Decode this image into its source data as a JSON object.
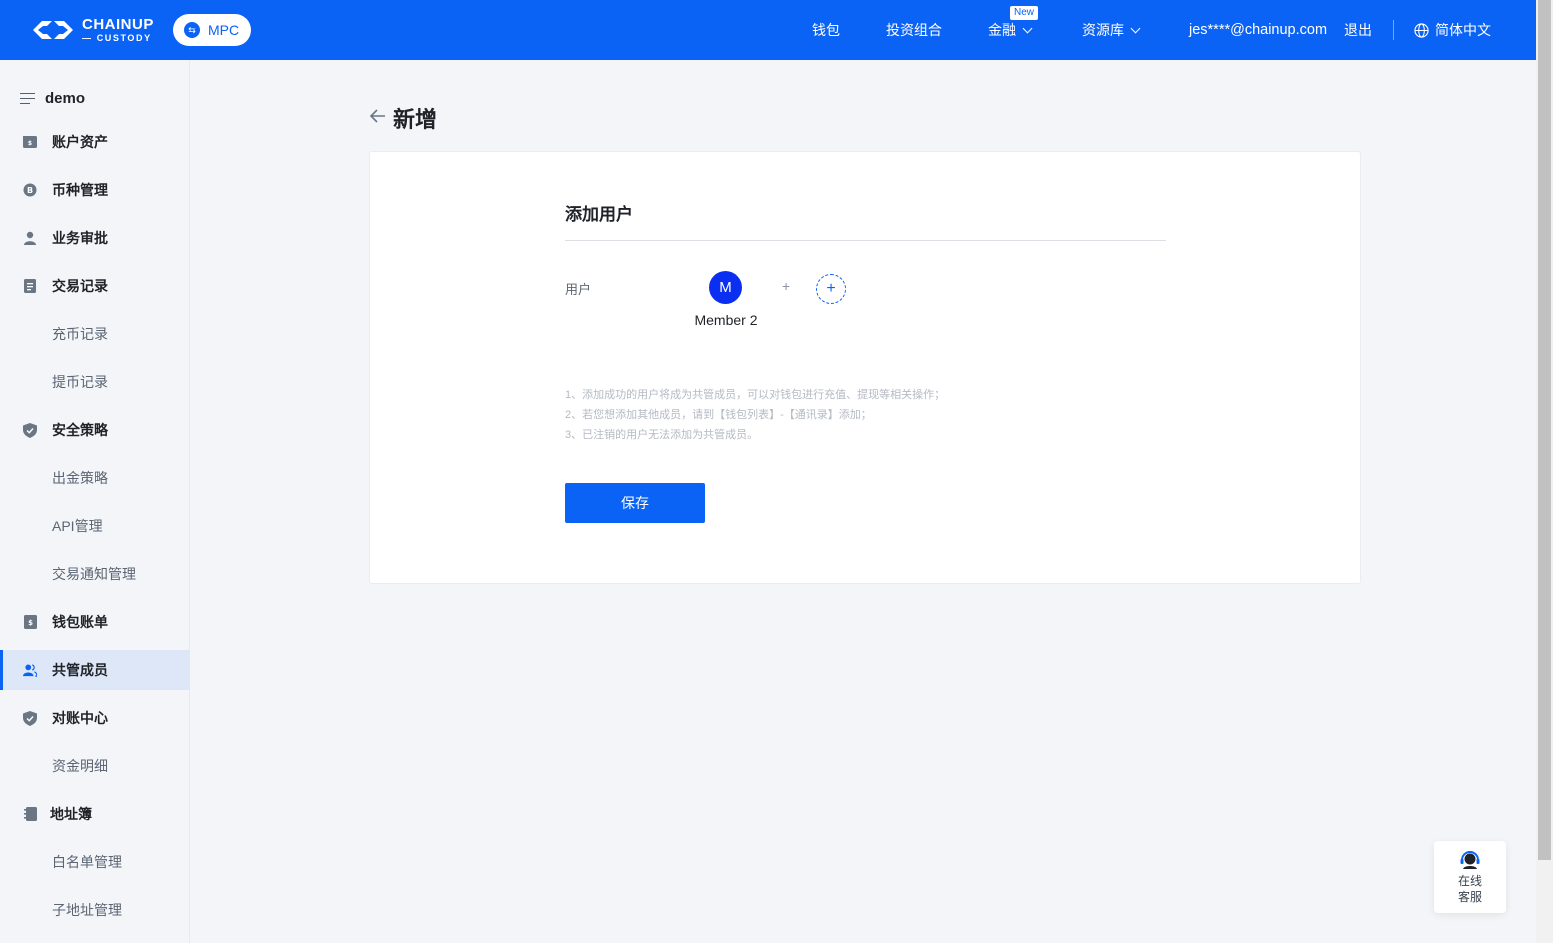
{
  "brand": {
    "logo_line1": "CHAINUP",
    "logo_line2": "— CUSTODY",
    "mpc_label": "MPC"
  },
  "nav": {
    "wallet": "钱包",
    "portfolio": "投资组合",
    "finance": "金融",
    "finance_badge": "New",
    "resources": "资源库",
    "user_email": "jes****@chainup.com",
    "logout": "退出",
    "language": "简体中文"
  },
  "sidebar": {
    "org_name": "demo",
    "items": [
      {
        "label": "账户资产",
        "type": "parent",
        "icon": "account-assets-icon"
      },
      {
        "label": "币种管理",
        "type": "parent",
        "icon": "coin-icon"
      },
      {
        "label": "业务审批",
        "type": "parent",
        "icon": "person-icon"
      },
      {
        "label": "交易记录",
        "type": "parent",
        "icon": "document-icon"
      },
      {
        "label": "充币记录",
        "type": "child"
      },
      {
        "label": "提币记录",
        "type": "child"
      },
      {
        "label": "安全策略",
        "type": "parent",
        "icon": "shield-icon"
      },
      {
        "label": "出金策略",
        "type": "child"
      },
      {
        "label": "API管理",
        "type": "child"
      },
      {
        "label": "交易通知管理",
        "type": "child"
      },
      {
        "label": "钱包账单",
        "type": "parent",
        "icon": "bill-icon"
      },
      {
        "label": "共管成员",
        "type": "parent",
        "icon": "members-icon",
        "active": true
      },
      {
        "label": "对账中心",
        "type": "parent",
        "icon": "shield-icon"
      },
      {
        "label": "资金明细",
        "type": "child"
      },
      {
        "label": "地址簿",
        "type": "parent",
        "icon": "address-book-icon"
      },
      {
        "label": "白名单管理",
        "type": "child"
      },
      {
        "label": "子地址管理",
        "type": "child"
      }
    ]
  },
  "page": {
    "title": "新增",
    "section_title": "添加用户",
    "user_label": "用户",
    "member": {
      "initial": "M",
      "name": "Member 2"
    },
    "plus_separator": "+",
    "add_symbol": "+",
    "notes": [
      "1、添加成功的用户将成为共管成员，可以对钱包进行充值、提现等相关操作；",
      "2、若您想添加其他成员，请到【钱包列表】-【通讯录】添加；",
      "3、已注销的用户无法添加为共管成员。"
    ],
    "save_label": "保存"
  },
  "support": {
    "label": "在线客服"
  },
  "colors": {
    "primary": "#0b63f6",
    "avatar": "#0b2ff0",
    "active_bg": "#dde7f8"
  }
}
